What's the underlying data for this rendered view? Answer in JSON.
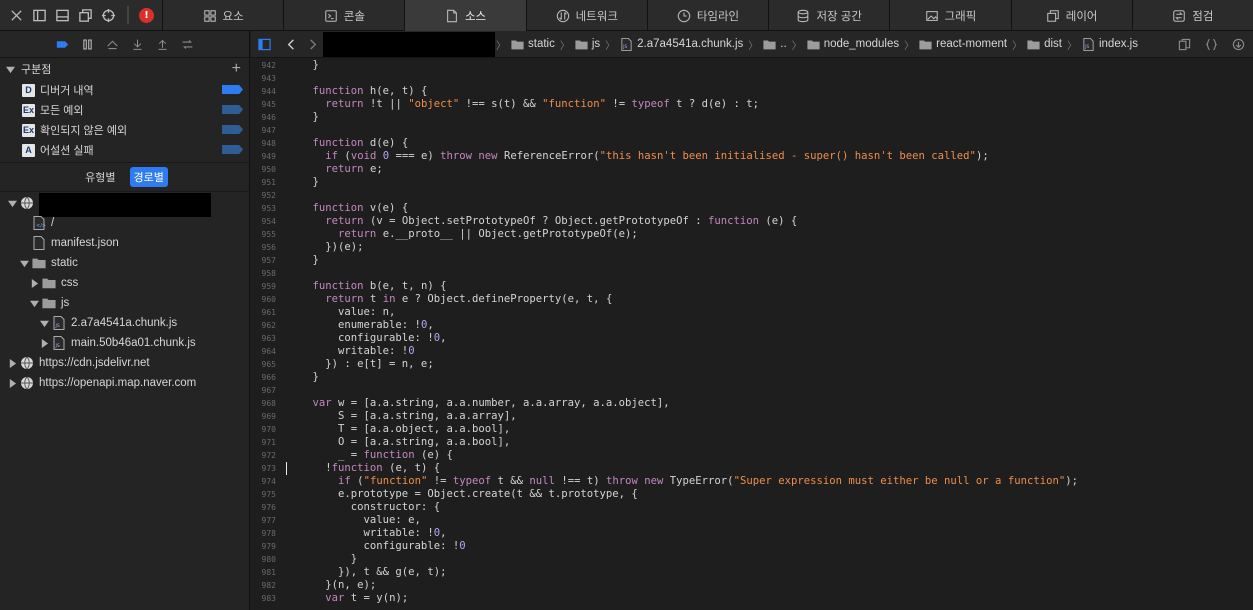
{
  "toolbar": {
    "controls": [
      "close-icon",
      "dock-sidebar-icon",
      "dock-bottom-icon",
      "undock-icon",
      "target-icon"
    ],
    "error_badge": "!",
    "tabs": [
      {
        "label": "요소",
        "icon": "elements-icon"
      },
      {
        "label": "콘솔",
        "icon": "console-icon"
      },
      {
        "label": "소스",
        "icon": "sources-icon",
        "active": true
      },
      {
        "label": "네트워크",
        "icon": "network-icon"
      },
      {
        "label": "타임라인",
        "icon": "timeline-icon"
      },
      {
        "label": "저장 공간",
        "icon": "storage-icon"
      },
      {
        "label": "그래픽",
        "icon": "graphics-icon"
      },
      {
        "label": "레이어",
        "icon": "layers-icon"
      },
      {
        "label": "점검",
        "icon": "audit-icon"
      }
    ]
  },
  "sidebar": {
    "breakpoints_header": "구분점",
    "breakpoints": [
      {
        "badge": "D",
        "label": "디버거 내역",
        "active": true
      },
      {
        "badge": "Ex",
        "label": "모든 예외",
        "active": false
      },
      {
        "badge": "Ex",
        "label": "확인되지 않은 예외",
        "active": false
      },
      {
        "badge": "A",
        "label": "어설션 실패",
        "active": false
      }
    ],
    "grouping": {
      "by_type": "유형별",
      "by_path": "경로별",
      "selected": "경로별"
    },
    "tree": [
      {
        "label": "",
        "kind": "origin-redacted",
        "depth": 0,
        "expanded": true
      },
      {
        "label": "/",
        "kind": "html",
        "depth": 1
      },
      {
        "label": "manifest.json",
        "kind": "file",
        "depth": 1
      },
      {
        "label": "static",
        "kind": "folder",
        "depth": 1,
        "expanded": true
      },
      {
        "label": "css",
        "kind": "folder",
        "depth": 2,
        "expanded": false
      },
      {
        "label": "js",
        "kind": "folder",
        "depth": 2,
        "expanded": true
      },
      {
        "label": "2.a7a4541a.chunk.js",
        "kind": "js",
        "depth": 3,
        "expanded": true
      },
      {
        "label": "main.50b46a01.chunk.js",
        "kind": "js",
        "depth": 3,
        "expanded": false
      },
      {
        "label": "https://cdn.jsdelivr.net",
        "kind": "origin",
        "depth": 0,
        "expanded": false
      },
      {
        "label": "https://openapi.map.naver.com",
        "kind": "origin",
        "depth": 0,
        "expanded": false
      }
    ]
  },
  "editor": {
    "breadcrumbs": [
      "static",
      "js",
      "2.a7a4541a.chunk.js",
      "..",
      "node_modules",
      "react-moment",
      "dist",
      "index.js"
    ],
    "lines": [
      {
        "n": "942",
        "html": "    }"
      },
      {
        "n": "943",
        "html": ""
      },
      {
        "n": "944",
        "html": "    <span class=\"kw\">function</span> h(e, t) {"
      },
      {
        "n": "945",
        "html": "      <span class=\"kw\">return</span> !t || <span class=\"str\">\"object\"</span> !== s(t) &amp;&amp; <span class=\"str\">\"function\"</span> != <span class=\"kw\">typeof</span> t ? d(e) : t;"
      },
      {
        "n": "946",
        "html": "    }"
      },
      {
        "n": "947",
        "html": ""
      },
      {
        "n": "948",
        "html": "    <span class=\"kw\">function</span> d(e) {"
      },
      {
        "n": "949",
        "html": "      <span class=\"kw\">if</span> (<span class=\"kw\">void</span> <span class=\"num\">0</span> === e) <span class=\"kw\">throw</span> <span class=\"kw\">new</span> ReferenceError(<span class=\"str\">\"this hasn't been initialised - super() hasn't been called\"</span>);"
      },
      {
        "n": "950",
        "html": "      <span class=\"kw\">return</span> e;"
      },
      {
        "n": "951",
        "html": "    }"
      },
      {
        "n": "952",
        "html": ""
      },
      {
        "n": "953",
        "html": "    <span class=\"kw\">function</span> v(e) {"
      },
      {
        "n": "954",
        "html": "      <span class=\"kw\">return</span> (v = Object.setPrototypeOf ? Object.getPrototypeOf : <span class=\"kw\">function</span> (e) {"
      },
      {
        "n": "955",
        "html": "        <span class=\"kw\">return</span> e.__proto__ || Object.getPrototypeOf(e);"
      },
      {
        "n": "956",
        "html": "      })(e);"
      },
      {
        "n": "957",
        "html": "    }"
      },
      {
        "n": "958",
        "html": ""
      },
      {
        "n": "959",
        "html": "    <span class=\"kw\">function</span> b(e, t, n) {"
      },
      {
        "n": "960",
        "html": "      <span class=\"kw\">return</span> t <span class=\"kw\">in</span> e ? Object.defineProperty(e, t, {"
      },
      {
        "n": "961",
        "html": "        value: n,"
      },
      {
        "n": "962",
        "html": "        enumerable: !<span class=\"num\">0</span>,"
      },
      {
        "n": "963",
        "html": "        configurable: !<span class=\"num\">0</span>,"
      },
      {
        "n": "964",
        "html": "        writable: !<span class=\"num\">0</span>"
      },
      {
        "n": "965",
        "html": "      }) : e[t] = n, e;"
      },
      {
        "n": "966",
        "html": "    }"
      },
      {
        "n": "967",
        "html": ""
      },
      {
        "n": "968",
        "html": "    <span class=\"kw\">var</span> w = [a.a.string, a.a.number, a.a.array, a.a.object],"
      },
      {
        "n": "969",
        "html": "        S = [a.a.string, a.a.array],"
      },
      {
        "n": "970",
        "html": "        T = [a.a.object, a.a.bool],"
      },
      {
        "n": "971",
        "html": "        O = [a.a.string, a.a.bool],"
      },
      {
        "n": "972",
        "html": "        _ = <span class=\"kw\">function</span> (e) {"
      },
      {
        "n": "973",
        "html": "      !<span class=\"kw\">function</span> (e, t) {",
        "cursor": true
      },
      {
        "n": "974",
        "html": "        <span class=\"kw\">if</span> (<span class=\"str\">\"function\"</span> != <span class=\"kw\">typeof</span> t &amp;&amp; <span class=\"kw\">null</span> !== t) <span class=\"kw\">throw</span> <span class=\"kw\">new</span> TypeError(<span class=\"str\">\"Super expression must either be null or a function\"</span>);"
      },
      {
        "n": "975",
        "html": "        e.prototype = Object.create(t &amp;&amp; t.prototype, {"
      },
      {
        "n": "976",
        "html": "          constructor: {"
      },
      {
        "n": "977",
        "html": "            value: e,"
      },
      {
        "n": "978",
        "html": "            writable: !<span class=\"num\">0</span>,"
      },
      {
        "n": "979",
        "html": "            configurable: !<span class=\"num\">0</span>"
      },
      {
        "n": "980",
        "html": "          }"
      },
      {
        "n": "981",
        "html": "        }), t &amp;&amp; g(e, t);"
      },
      {
        "n": "982",
        "html": "      }(n, e);"
      },
      {
        "n": "983",
        "html": "      <span class=\"kw\">var</span> t = y(n);"
      }
    ]
  }
}
